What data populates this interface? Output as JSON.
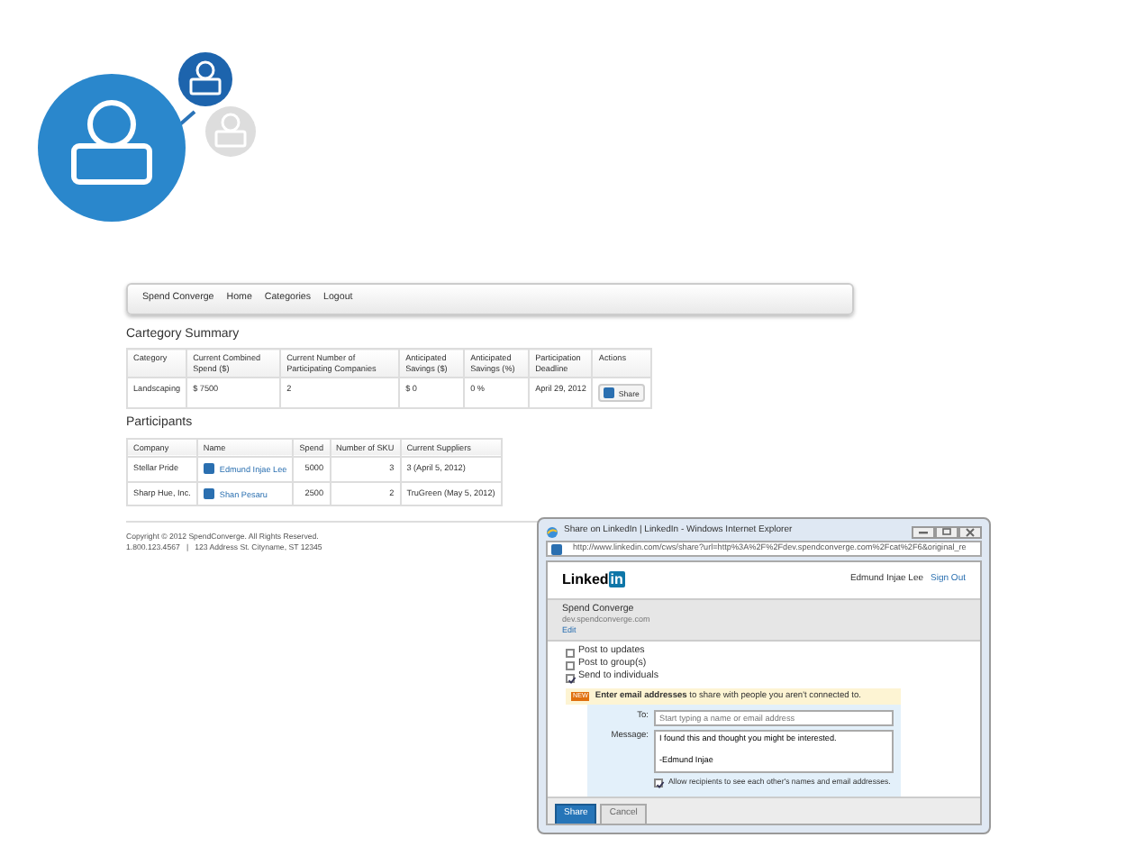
{
  "navbar": {
    "items": [
      "Spend Converge",
      "Home",
      "Categories",
      "Logout"
    ]
  },
  "category_summary": {
    "title": "Cartegory Summary",
    "columns": [
      "Category",
      "Current Combined Spend ($)",
      "Current Number of Participating Companies",
      "Anticipated Savings ($)",
      "Anticipated Savings (%)",
      "Participation Deadline",
      "Actions"
    ],
    "rows": [
      {
        "cells": [
          "Landscaping",
          "$ 7500",
          "2",
          "$ 0",
          "0 %",
          "April 29, 2012"
        ],
        "action": "Share"
      }
    ]
  },
  "participants": {
    "title": "Participants",
    "columns": [
      "Company",
      "Name",
      "Spend",
      "Number of SKU",
      "Current Suppliers"
    ],
    "rows": [
      {
        "company": "Stellar Pride",
        "name": "Edmund Injae Lee",
        "spend": "5000",
        "sku": "3",
        "suppliers": "3 (April 5, 2012)"
      },
      {
        "company": "Sharp Hue, Inc.",
        "name": "Shan Pesaru",
        "spend": "2500",
        "sku": "2",
        "suppliers": "TruGreen (May 5, 2012)"
      }
    ]
  },
  "footer": {
    "copyright": "Copyright © 2012 SpendConverge. All Rights Reserved.",
    "contact": "1.800.123.4567   |   123 Address St. Cityname, ST 12345"
  },
  "popup": {
    "title": "Share on LinkedIn | LinkedIn - Windows Internet Explorer",
    "url": "http://www.linkedin.com/cws/share?url=http%3A%2F%2Fdev.spendconverge.com%2Fcat%2F6&original_re",
    "logo": [
      "Linked",
      "in"
    ],
    "user": "Edmund Injae Lee",
    "sign_out": "Sign Out",
    "item": {
      "title": "Spend Converge",
      "domain": "dev.spendconverge.com",
      "edit": "Edit"
    },
    "options": [
      {
        "label": "Post to updates",
        "checked": false
      },
      {
        "label": "Post to group(s)",
        "checked": false
      },
      {
        "label": "Send to individuals",
        "checked": true
      }
    ],
    "notice": {
      "badge": "NEW",
      "text": "**Enter email addresses** to share with people you aren't connected to."
    },
    "to": {
      "label": "To:",
      "placeholder": "Start typing a name or email address"
    },
    "message": {
      "label": "Message:",
      "value": "I found this and thought you might be interested.\n\n-Edmund Injae"
    },
    "allow": {
      "label": "Allow recipients to see each other's names and email addresses.",
      "checked": true
    },
    "buttons": [
      "Share",
      "Cancel"
    ]
  }
}
